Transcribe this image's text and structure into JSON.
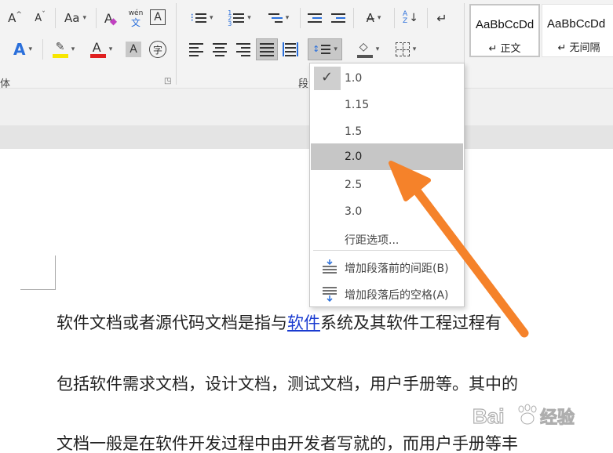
{
  "ribbon": {
    "font_group_label_partial": "体",
    "paragraph_group_label_partial": "段",
    "phonetic_icon_text": "wén",
    "phonetic_icon_char": "文",
    "border_char_icon": "A",
    "enclose_char_icon": "字",
    "grow_font": "A",
    "shrink_font": "A",
    "change_case": "Aa",
    "text_effects": "A",
    "highlight_letter": "A",
    "font_color_letter": "A",
    "char_shading": "A",
    "highlight_color": "#f7e600",
    "font_color": "#e02020",
    "text_effect_color": "#2a6fdb"
  },
  "styles": [
    {
      "sample": "AaBbCcDd",
      "name": "↵ 正文",
      "selected": true
    },
    {
      "sample": "AaBbCcDd",
      "name": "↵ 无间隔",
      "selected": false
    }
  ],
  "line_spacing_menu": {
    "options": [
      {
        "label": "1.0",
        "checked": true,
        "highlighted": false
      },
      {
        "label": "1.15",
        "checked": false,
        "highlighted": false
      },
      {
        "label": "1.5",
        "checked": false,
        "highlighted": false
      },
      {
        "label": "2.0",
        "checked": false,
        "highlighted": true
      },
      {
        "label": "2.5",
        "checked": false,
        "highlighted": false
      },
      {
        "label": "3.0",
        "checked": false,
        "highlighted": false
      }
    ],
    "more_options": "行距选项...",
    "add_space_before": "增加段落前的间距(B)",
    "add_space_after": "增加段落后的空格(A)",
    "check_glyph": "✓"
  },
  "document": {
    "line1_before_link": "软件文档或者源代码文档是指与",
    "line1_link": "软件",
    "line1_after_link": "系统及其软件工程过程有",
    "line2": "包括软件需求文档，设计文档，测试文档，用户手册等。其中的",
    "line3": "文档一般是在软件开发过程中由开发者写就的，而用户手册等丰"
  },
  "watermark": {
    "brand": "Bai",
    "suffix": "经验"
  },
  "colors": {
    "arrow": "#f5822a",
    "menu_highlight": "#c6c6c6",
    "link": "#1a3bd0"
  }
}
